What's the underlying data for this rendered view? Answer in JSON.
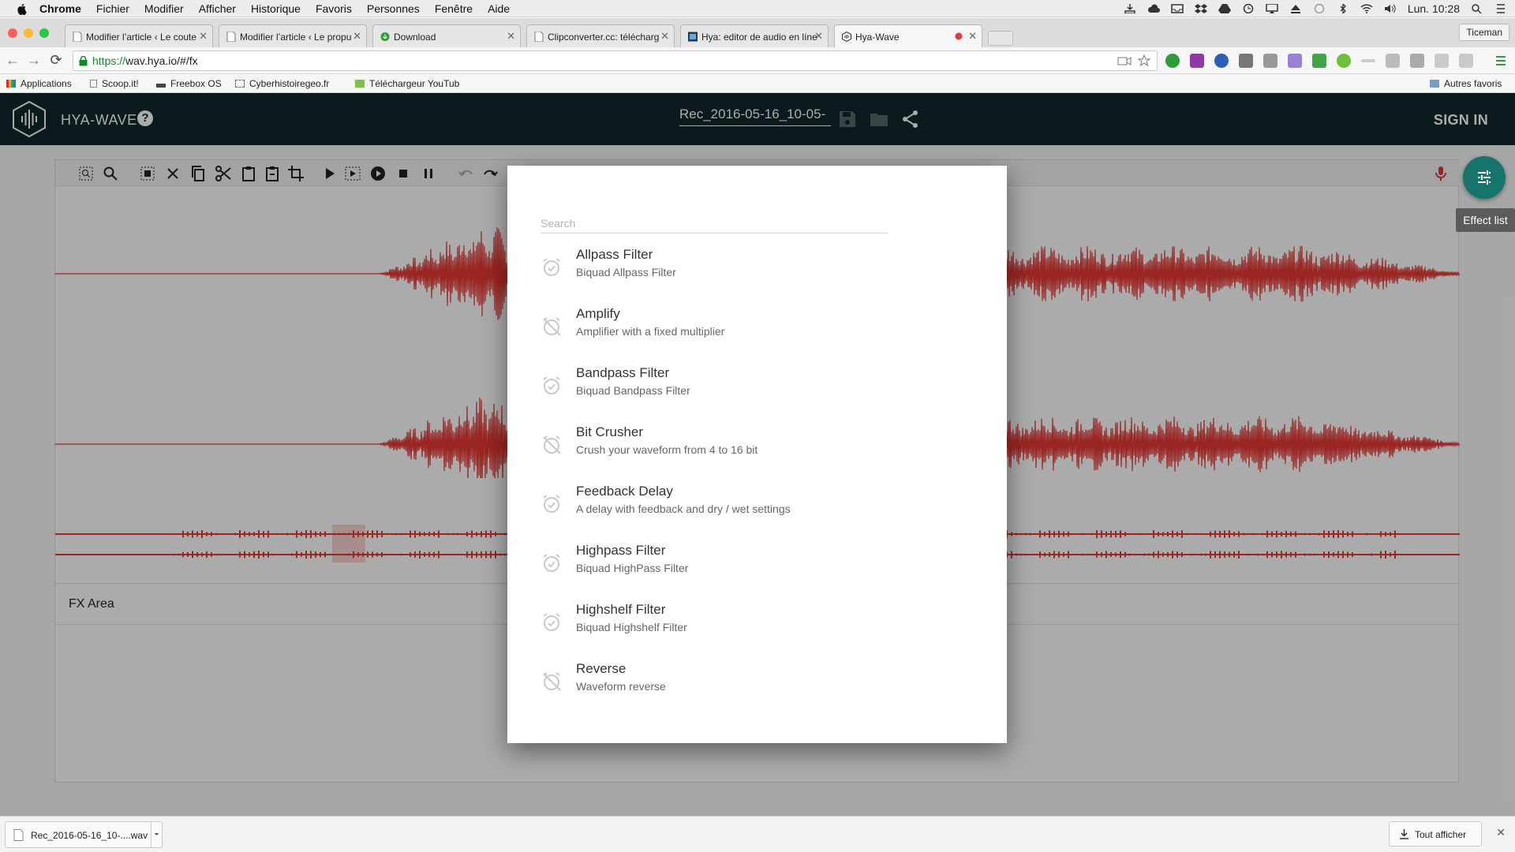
{
  "macbar": {
    "app": "Chrome",
    "menus": [
      "Fichier",
      "Modifier",
      "Afficher",
      "Historique",
      "Favoris",
      "Personnes",
      "Fenêtre",
      "Aide"
    ],
    "clock": "Lun. 10:28"
  },
  "tabs": [
    {
      "title": "Modifier l’article ‹ Le coute"
    },
    {
      "title": "Modifier l’article ‹ Le propu"
    },
    {
      "title": "Download"
    },
    {
      "title": "Clipconverter.cc: télécharg"
    },
    {
      "title": "Hya: editor de audio en líne"
    },
    {
      "title": "Hya-Wave"
    }
  ],
  "profile": "Ticeman",
  "address": {
    "scheme": "https://",
    "rest": "wav.hya.io/#/fx"
  },
  "bookmarks": [
    "Applications",
    "Scoop.it!",
    "Freebox OS",
    "Cyberhistoiregeo.fr",
    "Téléchargeur YouTub",
    "Autres favoris"
  ],
  "app": {
    "brand": "HYA-WAVE",
    "help": "?",
    "filename": "Rec_2016-05-16_10-05-",
    "signin": "SIGN IN"
  },
  "fx_area_title": "FX Area",
  "fab_tooltip": "Effect list",
  "modal": {
    "search_placeholder": "Search",
    "effects": [
      {
        "name": "Allpass Filter",
        "desc": "Biquad Allpass Filter",
        "icon": "alarm-on-icon"
      },
      {
        "name": "Amplify",
        "desc": "Amplifier with a fixed multiplier",
        "icon": "alarm-off-icon"
      },
      {
        "name": "Bandpass Filter",
        "desc": "Biquad Bandpass Filter",
        "icon": "alarm-on-icon"
      },
      {
        "name": "Bit Crusher",
        "desc": "Crush your waveform from 4 to 16 bit",
        "icon": "alarm-off-icon"
      },
      {
        "name": "Feedback Delay",
        "desc": "A delay with feedback and dry / wet settings",
        "icon": "alarm-on-icon"
      },
      {
        "name": "Highpass Filter",
        "desc": "Biquad HighPass Filter",
        "icon": "alarm-on-icon"
      },
      {
        "name": "Highshelf Filter",
        "desc": "Biquad Highshelf Filter",
        "icon": "alarm-on-icon"
      },
      {
        "name": "Reverse",
        "desc": "Waveform reverse",
        "icon": "alarm-off-icon"
      }
    ]
  },
  "downloads": {
    "file": "Rec_2016-05-16_10-....wav",
    "show_all": "Tout afficher"
  },
  "colors": {
    "appbar": "#11282a",
    "waveform": "#e53935",
    "fab": "#16756a",
    "record": "#e53935"
  }
}
